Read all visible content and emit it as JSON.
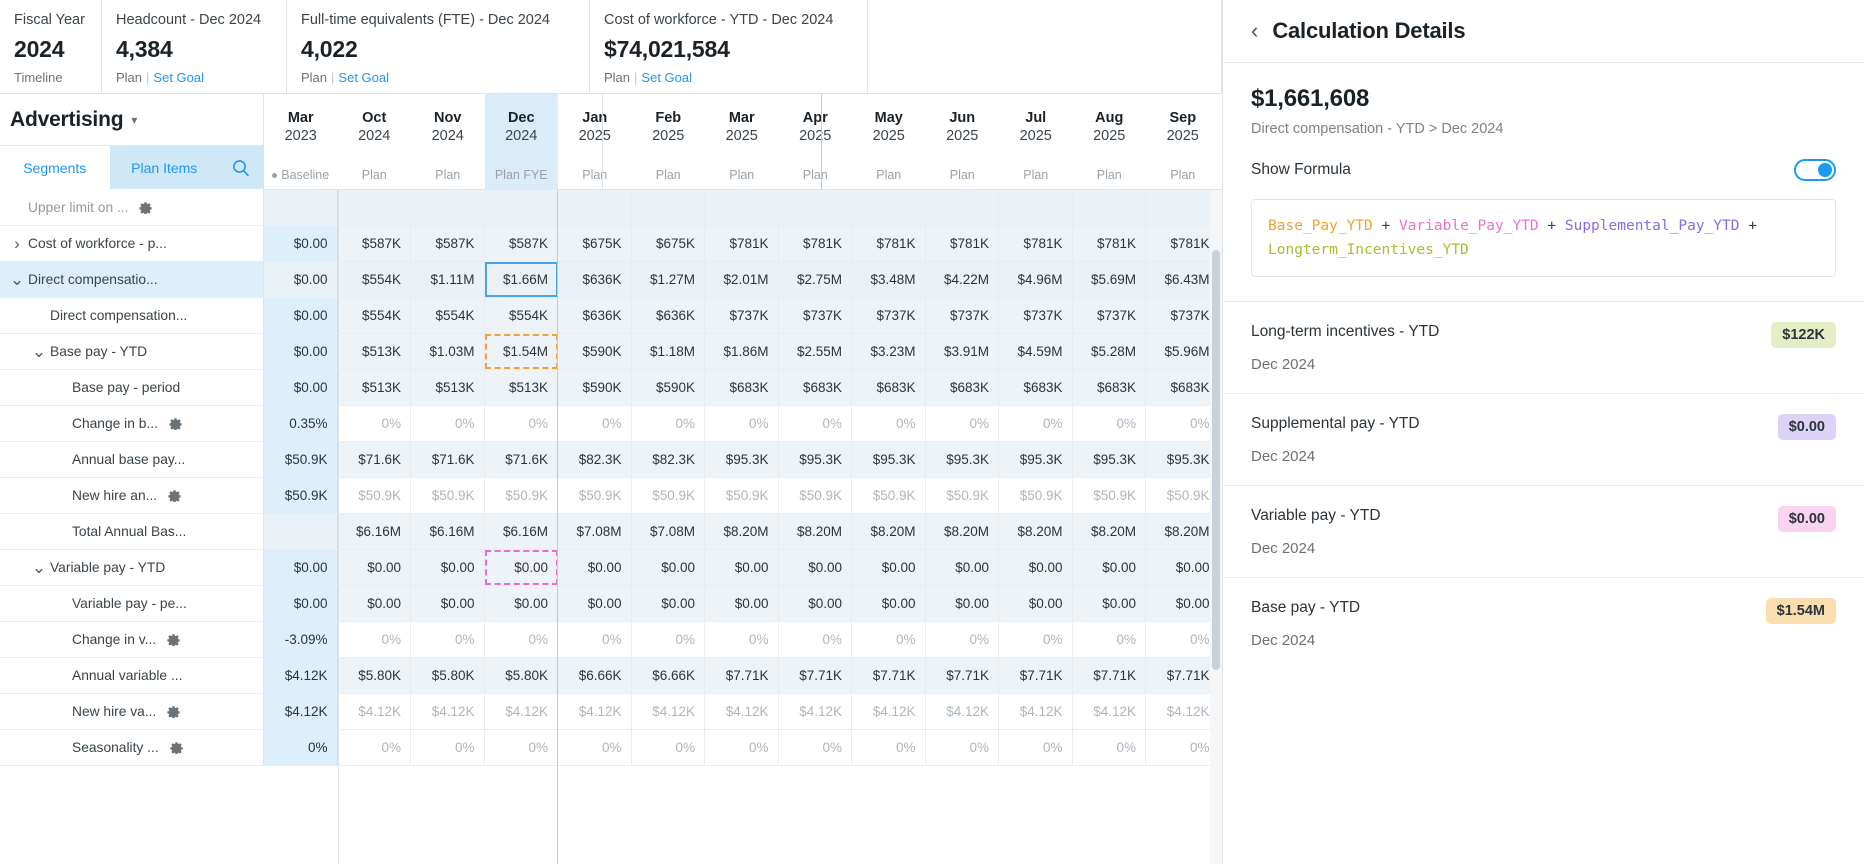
{
  "kpis": [
    {
      "title": "Fiscal Year",
      "value": "2024",
      "sub_left": "Timeline",
      "sub_link": ""
    },
    {
      "title": "Headcount - Dec 2024",
      "value": "4,384",
      "sub_left": "Plan",
      "sub_link": "Set Goal"
    },
    {
      "title": "Full-time equivalents (FTE) - Dec 2024",
      "value": "4,022",
      "sub_left": "Plan",
      "sub_link": "Set Goal"
    },
    {
      "title": "Cost of workforce - YTD - Dec 2024",
      "value": "$74,021,584",
      "sub_left": "Plan",
      "sub_link": "Set Goal"
    }
  ],
  "entity": {
    "name": "Advertising",
    "caret": "chevron-down"
  },
  "tabs": [
    {
      "label": "Segments",
      "active": false
    },
    {
      "label": "Plan Items",
      "active": true
    }
  ],
  "search_icon": "search-icon",
  "columns": [
    {
      "month": "Mar",
      "year": "2023",
      "scenario": "Baseline",
      "dot": true,
      "selected": false
    },
    {
      "month": "Oct",
      "year": "2024",
      "scenario": "Plan",
      "dot": false,
      "selected": false
    },
    {
      "month": "Nov",
      "year": "2024",
      "scenario": "Plan",
      "dot": false,
      "selected": false
    },
    {
      "month": "Dec",
      "year": "2024",
      "scenario": "Plan FYE",
      "dot": false,
      "selected": true
    },
    {
      "month": "Jan",
      "year": "2025",
      "scenario": "Plan",
      "dot": false,
      "selected": false
    },
    {
      "month": "Feb",
      "year": "2025",
      "scenario": "Plan",
      "dot": false,
      "selected": false
    },
    {
      "month": "Mar",
      "year": "2025",
      "scenario": "Plan",
      "dot": false,
      "selected": false
    },
    {
      "month": "Apr",
      "year": "2025",
      "scenario": "Plan",
      "dot": false,
      "selected": false
    },
    {
      "month": "May",
      "year": "2025",
      "scenario": "Plan",
      "dot": false,
      "selected": false
    },
    {
      "month": "Jun",
      "year": "2025",
      "scenario": "Plan",
      "dot": false,
      "selected": false
    },
    {
      "month": "Jul",
      "year": "2025",
      "scenario": "Plan",
      "dot": false,
      "selected": false
    },
    {
      "month": "Aug",
      "year": "2025",
      "scenario": "Plan",
      "dot": false,
      "selected": false
    },
    {
      "month": "Sep",
      "year": "2025",
      "scenario": "Plan",
      "dot": false,
      "selected": false
    }
  ],
  "rows": [
    {
      "label": "Upper limit on ...",
      "indent": 1,
      "twisty": "",
      "gear": true,
      "clipped": true,
      "selected": false,
      "muted": false,
      "values": [
        "",
        "",
        "",
        "",
        "",
        "",
        "",
        "",
        "",
        "",
        "",
        "",
        ""
      ]
    },
    {
      "label": "Cost of workforce - p...",
      "indent": 1,
      "twisty": "collapsed",
      "gear": false,
      "selected": false,
      "muted": false,
      "values": [
        "$0.00",
        "$587K",
        "$587K",
        "$587K",
        "$675K",
        "$675K",
        "$781K",
        "$781K",
        "$781K",
        "$781K",
        "$781K",
        "$781K",
        "$781K"
      ]
    },
    {
      "label": "Direct compensatio...",
      "indent": 1,
      "twisty": "expanded",
      "gear": false,
      "selected": true,
      "muted": false,
      "mark": {
        "index": 3,
        "style": "blue-solid"
      },
      "values": [
        "$0.00",
        "$554K",
        "$1.11M",
        "$1.66M",
        "$636K",
        "$1.27M",
        "$2.01M",
        "$2.75M",
        "$3.48M",
        "$4.22M",
        "$4.96M",
        "$5.69M",
        "$6.43M"
      ]
    },
    {
      "label": "Direct compensation...",
      "indent": 2,
      "twisty": "",
      "gear": false,
      "selected": false,
      "muted": false,
      "values": [
        "$0.00",
        "$554K",
        "$554K",
        "$554K",
        "$636K",
        "$636K",
        "$737K",
        "$737K",
        "$737K",
        "$737K",
        "$737K",
        "$737K",
        "$737K"
      ]
    },
    {
      "label": "Base pay - YTD",
      "indent": 2,
      "twisty": "expanded",
      "gear": false,
      "selected": false,
      "muted": false,
      "mark": {
        "index": 3,
        "style": "orange-dashed"
      },
      "values": [
        "$0.00",
        "$513K",
        "$1.03M",
        "$1.54M",
        "$590K",
        "$1.18M",
        "$1.86M",
        "$2.55M",
        "$3.23M",
        "$3.91M",
        "$4.59M",
        "$5.28M",
        "$5.96M"
      ]
    },
    {
      "label": "Base pay - period",
      "indent": 3,
      "twisty": "",
      "gear": false,
      "selected": false,
      "muted": false,
      "values": [
        "$0.00",
        "$513K",
        "$513K",
        "$513K",
        "$590K",
        "$590K",
        "$683K",
        "$683K",
        "$683K",
        "$683K",
        "$683K",
        "$683K",
        "$683K"
      ]
    },
    {
      "label": "Change in b...",
      "indent": 3,
      "twisty": "",
      "gear": true,
      "selected": false,
      "muted": true,
      "first_strong": true,
      "values": [
        "0.35%",
        "0%",
        "0%",
        "0%",
        "0%",
        "0%",
        "0%",
        "0%",
        "0%",
        "0%",
        "0%",
        "0%",
        "0%"
      ]
    },
    {
      "label": "Annual base pay...",
      "indent": 3,
      "twisty": "",
      "gear": false,
      "selected": false,
      "muted": false,
      "values": [
        "$50.9K",
        "$71.6K",
        "$71.6K",
        "$71.6K",
        "$82.3K",
        "$82.3K",
        "$95.3K",
        "$95.3K",
        "$95.3K",
        "$95.3K",
        "$95.3K",
        "$95.3K",
        "$95.3K"
      ]
    },
    {
      "label": "New hire an...",
      "indent": 3,
      "twisty": "",
      "gear": true,
      "selected": false,
      "muted": true,
      "first_strong": true,
      "values": [
        "$50.9K",
        "$50.9K",
        "$50.9K",
        "$50.9K",
        "$50.9K",
        "$50.9K",
        "$50.9K",
        "$50.9K",
        "$50.9K",
        "$50.9K",
        "$50.9K",
        "$50.9K",
        "$50.9K"
      ]
    },
    {
      "label": "Total Annual Bas...",
      "indent": 3,
      "twisty": "",
      "gear": false,
      "selected": false,
      "muted": false,
      "first_empty": true,
      "values": [
        "",
        "$6.16M",
        "$6.16M",
        "$6.16M",
        "$7.08M",
        "$7.08M",
        "$8.20M",
        "$8.20M",
        "$8.20M",
        "$8.20M",
        "$8.20M",
        "$8.20M",
        "$8.20M"
      ]
    },
    {
      "label": "Variable pay - YTD",
      "indent": 2,
      "twisty": "expanded",
      "gear": false,
      "selected": false,
      "muted": false,
      "mark": {
        "index": 3,
        "style": "pink-dashed"
      },
      "values": [
        "$0.00",
        "$0.00",
        "$0.00",
        "$0.00",
        "$0.00",
        "$0.00",
        "$0.00",
        "$0.00",
        "$0.00",
        "$0.00",
        "$0.00",
        "$0.00",
        "$0.00"
      ]
    },
    {
      "label": "Variable pay - pe...",
      "indent": 3,
      "twisty": "",
      "gear": false,
      "selected": false,
      "muted": false,
      "values": [
        "$0.00",
        "$0.00",
        "$0.00",
        "$0.00",
        "$0.00",
        "$0.00",
        "$0.00",
        "$0.00",
        "$0.00",
        "$0.00",
        "$0.00",
        "$0.00",
        "$0.00"
      ]
    },
    {
      "label": "Change in v...",
      "indent": 3,
      "twisty": "",
      "gear": true,
      "selected": false,
      "muted": true,
      "first_strong": true,
      "values": [
        "-3.09%",
        "0%",
        "0%",
        "0%",
        "0%",
        "0%",
        "0%",
        "0%",
        "0%",
        "0%",
        "0%",
        "0%",
        "0%"
      ]
    },
    {
      "label": "Annual variable ...",
      "indent": 3,
      "twisty": "",
      "gear": false,
      "selected": false,
      "muted": false,
      "values": [
        "$4.12K",
        "$5.80K",
        "$5.80K",
        "$5.80K",
        "$6.66K",
        "$6.66K",
        "$7.71K",
        "$7.71K",
        "$7.71K",
        "$7.71K",
        "$7.71K",
        "$7.71K",
        "$7.71K"
      ]
    },
    {
      "label": "New hire va...",
      "indent": 3,
      "twisty": "",
      "gear": true,
      "selected": false,
      "muted": true,
      "first_strong": true,
      "values": [
        "$4.12K",
        "$4.12K",
        "$4.12K",
        "$4.12K",
        "$4.12K",
        "$4.12K",
        "$4.12K",
        "$4.12K",
        "$4.12K",
        "$4.12K",
        "$4.12K",
        "$4.12K",
        "$4.12K"
      ]
    },
    {
      "label": "Seasonality ...",
      "indent": 3,
      "twisty": "",
      "gear": true,
      "selected": false,
      "muted": true,
      "first_strong": true,
      "first_highlight": true,
      "values": [
        "0%",
        "0%",
        "0%",
        "0%",
        "0%",
        "0%",
        "0%",
        "0%",
        "0%",
        "0%",
        "0%",
        "0%",
        "0%"
      ]
    }
  ],
  "panel": {
    "back_icon": "chevron-left-icon",
    "title": "Calculation Details",
    "value": "$1,661,608",
    "path": "Direct compensation - YTD > Dec 2024",
    "toggle_label": "Show Formula",
    "toggle_on": true,
    "formula_tokens": [
      {
        "text": "Base_Pay_YTD",
        "color": "#f0a02c"
      },
      {
        "text": " + ",
        "color": "#3b444a"
      },
      {
        "text": "Variable_Pay_YTD",
        "color": "#e772cf"
      },
      {
        "text": " + ",
        "color": "#3b444a"
      },
      {
        "text": "Supplemental_Pay_YTD",
        "color": "#8a6ae8"
      },
      {
        "text": " + ",
        "color": "#3b444a"
      },
      {
        "text": "Longterm_Incentives_YTD",
        "color": "#9fc22e"
      }
    ],
    "items": [
      {
        "label": "Long-term incentives - YTD",
        "date": "Dec 2024",
        "badge": "$122K",
        "badge_bg": "#e4edc4"
      },
      {
        "label": "Supplemental pay - YTD",
        "date": "Dec 2024",
        "badge": "$0.00",
        "badge_bg": "#ddd3f7"
      },
      {
        "label": "Variable pay - YTD",
        "date": "Dec 2024",
        "badge": "$0.00",
        "badge_bg": "#f9d3ef"
      },
      {
        "label": "Base pay - YTD",
        "date": "Dec 2024",
        "badge": "$1.54M",
        "badge_bg": "#fbdeb0"
      }
    ]
  }
}
